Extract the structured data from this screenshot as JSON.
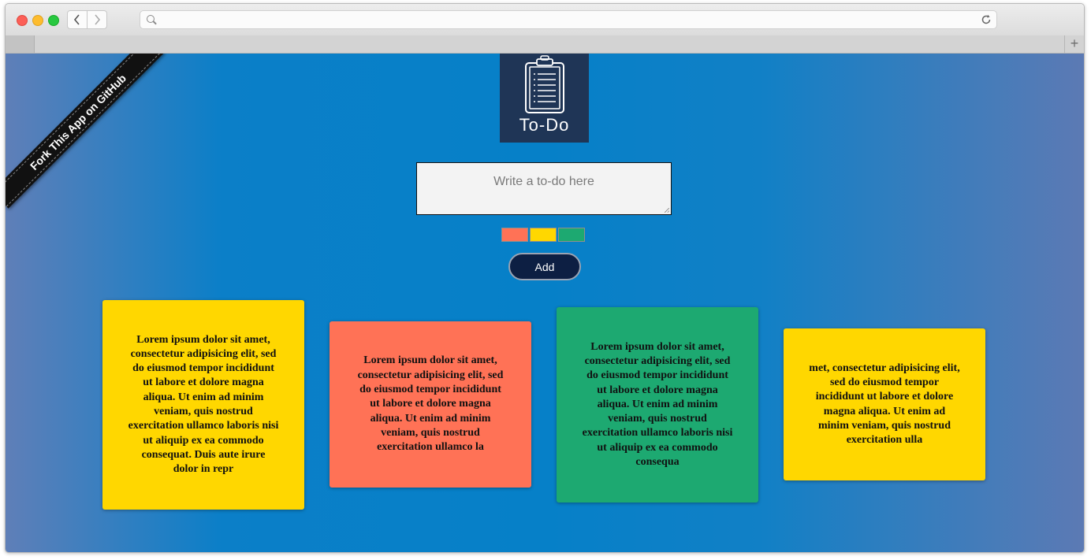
{
  "browser": {
    "address_value": "",
    "back_icon": "chevron-left-icon",
    "forward_icon": "chevron-right-icon",
    "reload_icon": "reload-icon",
    "new_tab_icon": "plus-icon"
  },
  "ribbon": {
    "label": "Fork This App on GitHub"
  },
  "logo": {
    "title": "To-Do",
    "icon": "clipboard-icon",
    "background": "#1f3556"
  },
  "input": {
    "placeholder": "Write a to-do here",
    "value": ""
  },
  "colors": [
    {
      "name": "coral",
      "hex": "#ff7256"
    },
    {
      "name": "yellow",
      "hex": "#ffd700"
    },
    {
      "name": "green",
      "hex": "#1da971"
    }
  ],
  "add_button": {
    "label": "Add"
  },
  "notes": [
    {
      "color": "#ffd700",
      "text": "Lorem ipsum dolor sit amet, consectetur adipisicing elit, sed do eiusmod tempor incididunt ut labore et dolore magna aliqua. Ut enim ad minim veniam, quis nostrud exercitation ullamco laboris nisi ut aliquip ex ea commodo consequat. Duis aute irure dolor in repr"
    },
    {
      "color": "#ff7256",
      "text": "Lorem ipsum dolor sit amet, consectetur adipisicing elit, sed do eiusmod tempor incididunt ut labore et dolore magna aliqua. Ut enim ad minim veniam, quis nostrud exercitation ullamco la"
    },
    {
      "color": "#1da971",
      "text": "Lorem ipsum dolor sit amet, consectetur adipisicing elit, sed do eiusmod tempor incididunt ut labore et dolore magna aliqua. Ut enim ad minim veniam, quis nostrud exercitation ullamco laboris nisi ut aliquip ex ea commodo consequa"
    },
    {
      "color": "#ffd700",
      "text": "met, consectetur adipisicing elit, sed do eiusmod tempor incididunt ut labore et dolore magna aliqua. Ut enim ad minim veniam, quis nostrud exercitation ulla"
    }
  ]
}
